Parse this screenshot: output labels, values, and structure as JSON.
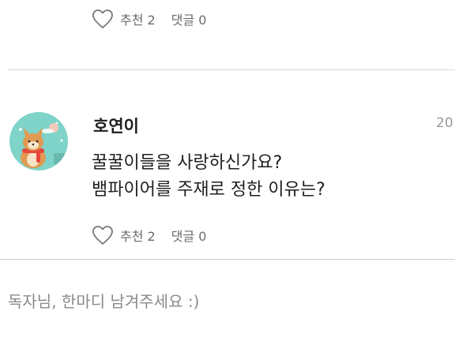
{
  "comments": [
    {
      "actions": {
        "recommend_label": "추천",
        "recommend_count": "2",
        "reply_label": "댓글",
        "reply_count": "0"
      }
    },
    {
      "author": "호연이",
      "date": "20",
      "body_line_1": "꿀꿀이들을 사랑하신가요?",
      "body_line_2": "뱀파이어를 주재로 정한 이유는?",
      "actions": {
        "recommend_label": "추천",
        "recommend_count": "2",
        "reply_label": "댓글",
        "reply_count": "0"
      }
    }
  ],
  "comment_input": {
    "placeholder": "독자님, 한마디 남겨주세요 :)"
  },
  "colors": {
    "avatar_bg": "#7fd3c8",
    "scarf": "#e8473c",
    "fox": "#e09a52",
    "text_muted": "#6a6a6a"
  },
  "icons": {
    "recommend": "heart-outline-icon",
    "avatar": "fox-avatar-illustration"
  }
}
